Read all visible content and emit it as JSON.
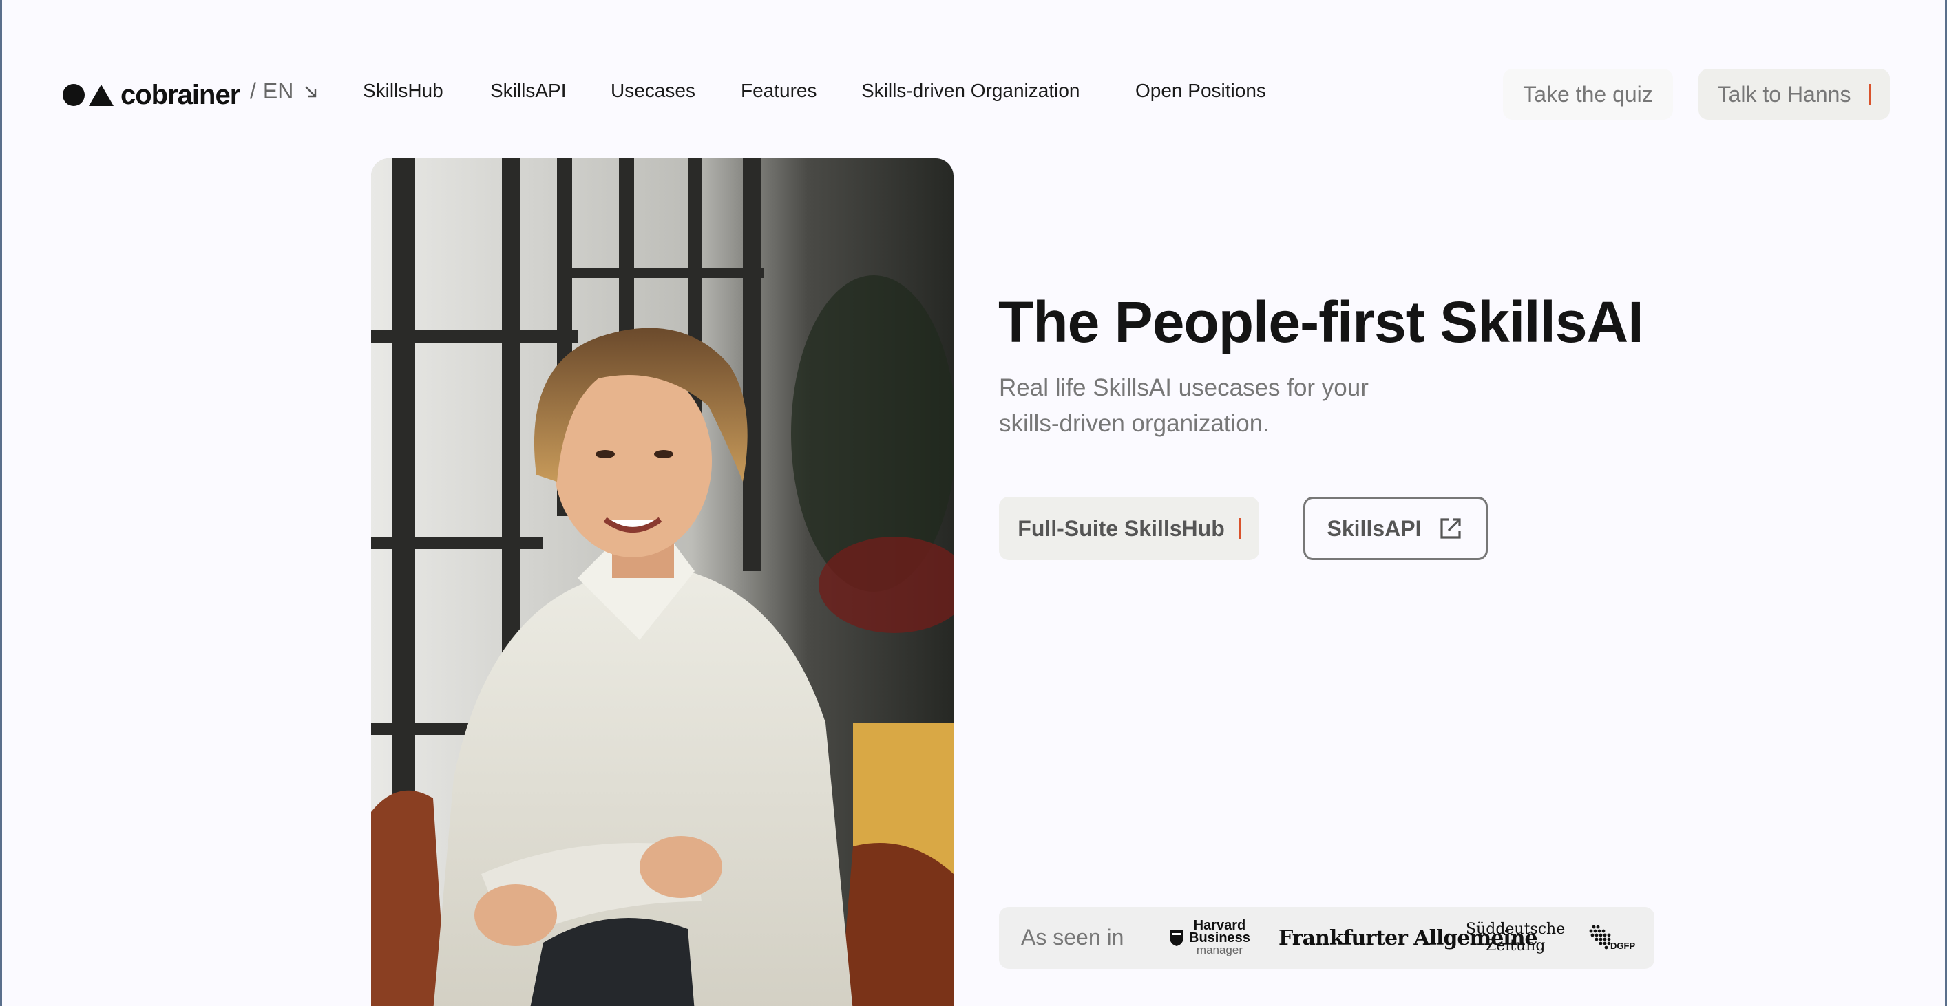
{
  "header": {
    "logo_text": "cobrainer",
    "language": "EN",
    "language_prefix": "/",
    "nav": [
      {
        "label": "SkillsHub"
      },
      {
        "label": "SkillsAPI"
      },
      {
        "label": "Usecases"
      },
      {
        "label": "Features"
      },
      {
        "label": "Skills-driven Organization"
      },
      {
        "label": "Open Positions"
      }
    ],
    "quiz_button": "Take the quiz",
    "contact_button": "Talk to Hanns"
  },
  "hero": {
    "title": "The People-first SkillsAI",
    "subtitle_line1": "Real life SkillsAI usecases for your",
    "subtitle_line2": "skills-driven organization.",
    "primary_button": "Full-Suite SkillsHub",
    "secondary_button": "SkillsAPI",
    "photo_icon": "person-photo"
  },
  "press": {
    "label": "As seen in",
    "logos": [
      {
        "name": "Harvard Business manager",
        "line1": "Harvard",
        "line2": "Business",
        "line3": "manager"
      },
      {
        "name": "Frankfurter Allgemeine",
        "text": "Frankfurter Allgemeine"
      },
      {
        "name": "Süddeutsche Zeitung",
        "line1": "Süddeutsche",
        "line2": "Zeitung"
      },
      {
        "name": "DGFP",
        "text": "DGFP"
      }
    ]
  },
  "colors": {
    "background": "#fbfaff",
    "button_bg": "#efefec",
    "accent": "#d9532c",
    "text_dark": "#141414",
    "text_muted": "#777777"
  }
}
